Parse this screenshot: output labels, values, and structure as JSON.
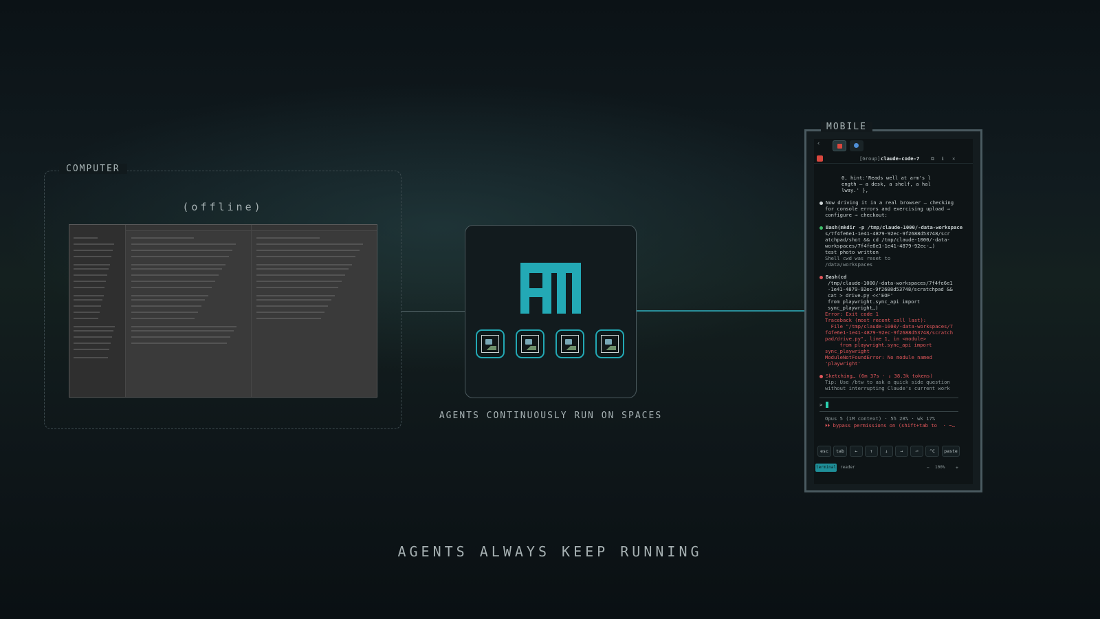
{
  "computer": {
    "label": "COMPUTER",
    "status": "(offline)"
  },
  "hub": {
    "caption": "AGENTS CONTINUOUSLY RUN ON SPACES",
    "accent_color": "#23a9b5",
    "agent_count": 4
  },
  "mobile": {
    "label": "MOBILE",
    "header_title_prefix": "[Group]",
    "header_title": "claude-code-7",
    "lines": [
      {
        "text": "0, hint:'Reads well at arm's l",
        "style": ""
      },
      {
        "text": "ength — a desk, a shelf, a hal",
        "style": ""
      },
      {
        "text": "lway.' },",
        "style": ""
      },
      {
        "text": "Now driving it in a real browser — checking",
        "style": ""
      },
      {
        "text": "for console errors and exercising upload →",
        "style": ""
      },
      {
        "text": "configure → checkout:",
        "style": ""
      },
      {
        "text": "Bash(mkdir -p /tmp/claude-1000/-data-workspace",
        "style": ""
      },
      {
        "text": "s/7f4fe6e1-1e41-4879-92ec-9f2688d53748/scr",
        "style": ""
      },
      {
        "text": "atchpad/shot && cd /tmp/claude-1000/-data-",
        "style": ""
      },
      {
        "text": "workspaces/7f4fe6e1-1e41-4879-92ec-…)",
        "style": ""
      },
      {
        "text": "test photo written",
        "style": ""
      },
      {
        "text": "Shell cwd was reset to",
        "style": "muted"
      },
      {
        "text": "/data/workspaces",
        "style": "muted"
      },
      {
        "text": "Bash(cd",
        "style": ""
      },
      {
        "text": "/tmp/claude-1000/-data-workspaces/7f4fe6e1",
        "style": ""
      },
      {
        "text": "-1e41-4879-92ec-9f2688d53748/scratchpad &&",
        "style": ""
      },
      {
        "text": "cat > drive.py <<'EOF'",
        "style": ""
      },
      {
        "text": "from playwright.sync_api import",
        "style": ""
      },
      {
        "text": "sync_playwright…)",
        "style": ""
      },
      {
        "text": "Error: Exit code 1",
        "style": "red"
      },
      {
        "text": "Traceback (most recent call last):",
        "style": "red"
      },
      {
        "text": "  File \"/tmp/claude-1000/-data-workspaces/7",
        "style": "red"
      },
      {
        "text": "f4fe6e1-1e41-4879-92ec-9f2688d53748/scratch",
        "style": "red"
      },
      {
        "text": "pad/drive.py\", line 1, in <module>",
        "style": "red"
      },
      {
        "text": "    from playwright.sync_api import",
        "style": "red"
      },
      {
        "text": "sync_playwright",
        "style": "red"
      },
      {
        "text": "ModuleNotFoundError: No module named",
        "style": "red"
      },
      {
        "text": "'playwright'",
        "style": "red"
      },
      {
        "text": "Sketching… (6m 37s · ↓ 38.3k tokens)",
        "style": "red"
      },
      {
        "text": "Tip: Use /btw to ask a quick side question",
        "style": "muted"
      },
      {
        "text": "without interrupting Claude's current work",
        "style": "muted"
      }
    ],
    "prompt": ">",
    "status_line": "Opus 5 (1M context) · 5h 28% · wk 17%",
    "permissions_line": "⏵⏵ bypass permissions on (shift+tab to  · ~…",
    "keys": [
      "esc",
      "tab",
      "←",
      "↑",
      "↓",
      "→",
      "⏎",
      "^C",
      "paste"
    ],
    "bottom_tabs": [
      "terminal",
      "reader"
    ],
    "zoom_minus": "−",
    "zoom": "100%",
    "zoom_plus": "+"
  },
  "tagline": "AGENTS ALWAYS KEEP RUNNING"
}
